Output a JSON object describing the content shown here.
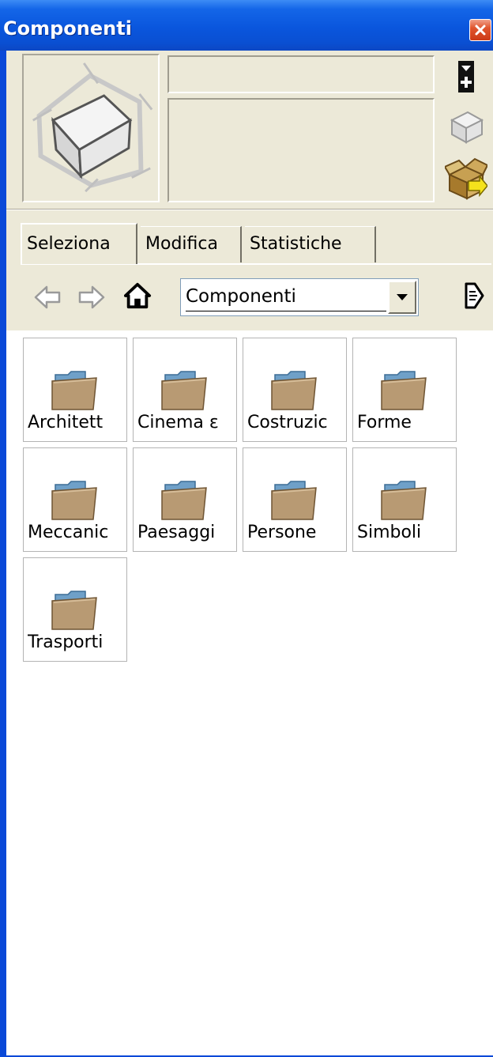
{
  "window": {
    "title": "Componenti"
  },
  "tabs": [
    {
      "label": "Seleziona",
      "active": true
    },
    {
      "label": "Modifica",
      "active": false
    },
    {
      "label": "Statistiche",
      "active": false
    }
  ],
  "navigation": {
    "location": "Componenti"
  },
  "icons": {
    "close": "close-icon",
    "back": "back-arrow-icon",
    "forward": "forward-arrow-icon",
    "home": "home-icon",
    "details": "details-arrow-icon",
    "expand": "expand-icon",
    "component": "component-cube-icon",
    "open_box": "open-box-icon",
    "folder": "folder-icon"
  },
  "folders": [
    {
      "label": "Architett"
    },
    {
      "label": "Cinema ε"
    },
    {
      "label": "Costruzic"
    },
    {
      "label": "Forme"
    },
    {
      "label": "Meccanic"
    },
    {
      "label": "Paesaggi"
    },
    {
      "label": "Persone"
    },
    {
      "label": "Simboli"
    },
    {
      "label": "Trasporti"
    }
  ],
  "colors": {
    "titlebar": "#0a56dd",
    "panel": "#ece9d8",
    "close_button": "#e0552e"
  }
}
